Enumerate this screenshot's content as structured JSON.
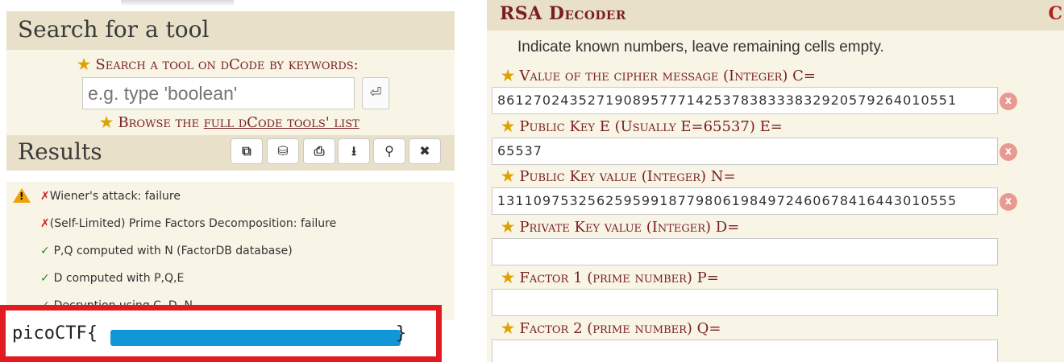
{
  "left_panel": {
    "search_title": "Search for a tool",
    "search_label": "Search a tool on dCode by keywords:",
    "search_placeholder": "e.g. type 'boolean'",
    "search_button_icon": "enter-icon",
    "browse_prefix": "Browse the ",
    "browse_link": "full dCode tools' list",
    "results_title": "Results",
    "result_buttons": [
      {
        "icon": "copy-icon",
        "glyph": "⧉"
      },
      {
        "icon": "database-icon",
        "glyph": "⛁"
      },
      {
        "icon": "print-icon",
        "glyph": "⎙"
      },
      {
        "icon": "download-icon",
        "glyph": "⭳"
      },
      {
        "icon": "pin-icon",
        "glyph": "⚲"
      },
      {
        "icon": "close-icon",
        "glyph": "✖"
      }
    ],
    "results": [
      {
        "status": "fail",
        "text": "Wiener's attack: failure"
      },
      {
        "status": "fail",
        "text": "(Self-Limited) Prime Factors Decomposition: failure"
      },
      {
        "status": "ok",
        "text": "P,Q computed with N (FactorDB database)"
      },
      {
        "status": "ok",
        "text": "D computed with P,Q,E"
      },
      {
        "status": "ok",
        "text": "Decryption using C, D, N"
      }
    ],
    "flag_prefix": "picoCTF{",
    "flag_suffix": "}"
  },
  "right_panel": {
    "title": "RSA Decoder",
    "title_extra": "C",
    "instructions": "Indicate known numbers, leave remaining cells empty.",
    "fields": [
      {
        "label": "Value of the cipher message (Integer) C=",
        "value": "861270243527190895777142537838333832920579264010551"
      },
      {
        "label": "Public Key E (Usually E=65537) E=",
        "value": "65537"
      },
      {
        "label": "Public Key value (Integer) N=",
        "value": "131109753256259599187798061984972460678416443010555"
      },
      {
        "label": "Private Key value (Integer) D=",
        "value": ""
      },
      {
        "label": "Factor 1 (prime number) P=",
        "value": ""
      },
      {
        "label": "Factor 2 (prime number) Q=",
        "value": ""
      }
    ],
    "clear_glyph": "x"
  },
  "colors": {
    "header_bg": "#e8e0c9",
    "panel_bg": "#f8f4e6",
    "accent_dark_red": "#7a1f1f",
    "star": "#e0a000",
    "highlight_box": "#e11b22",
    "redaction": "#1197d8"
  }
}
